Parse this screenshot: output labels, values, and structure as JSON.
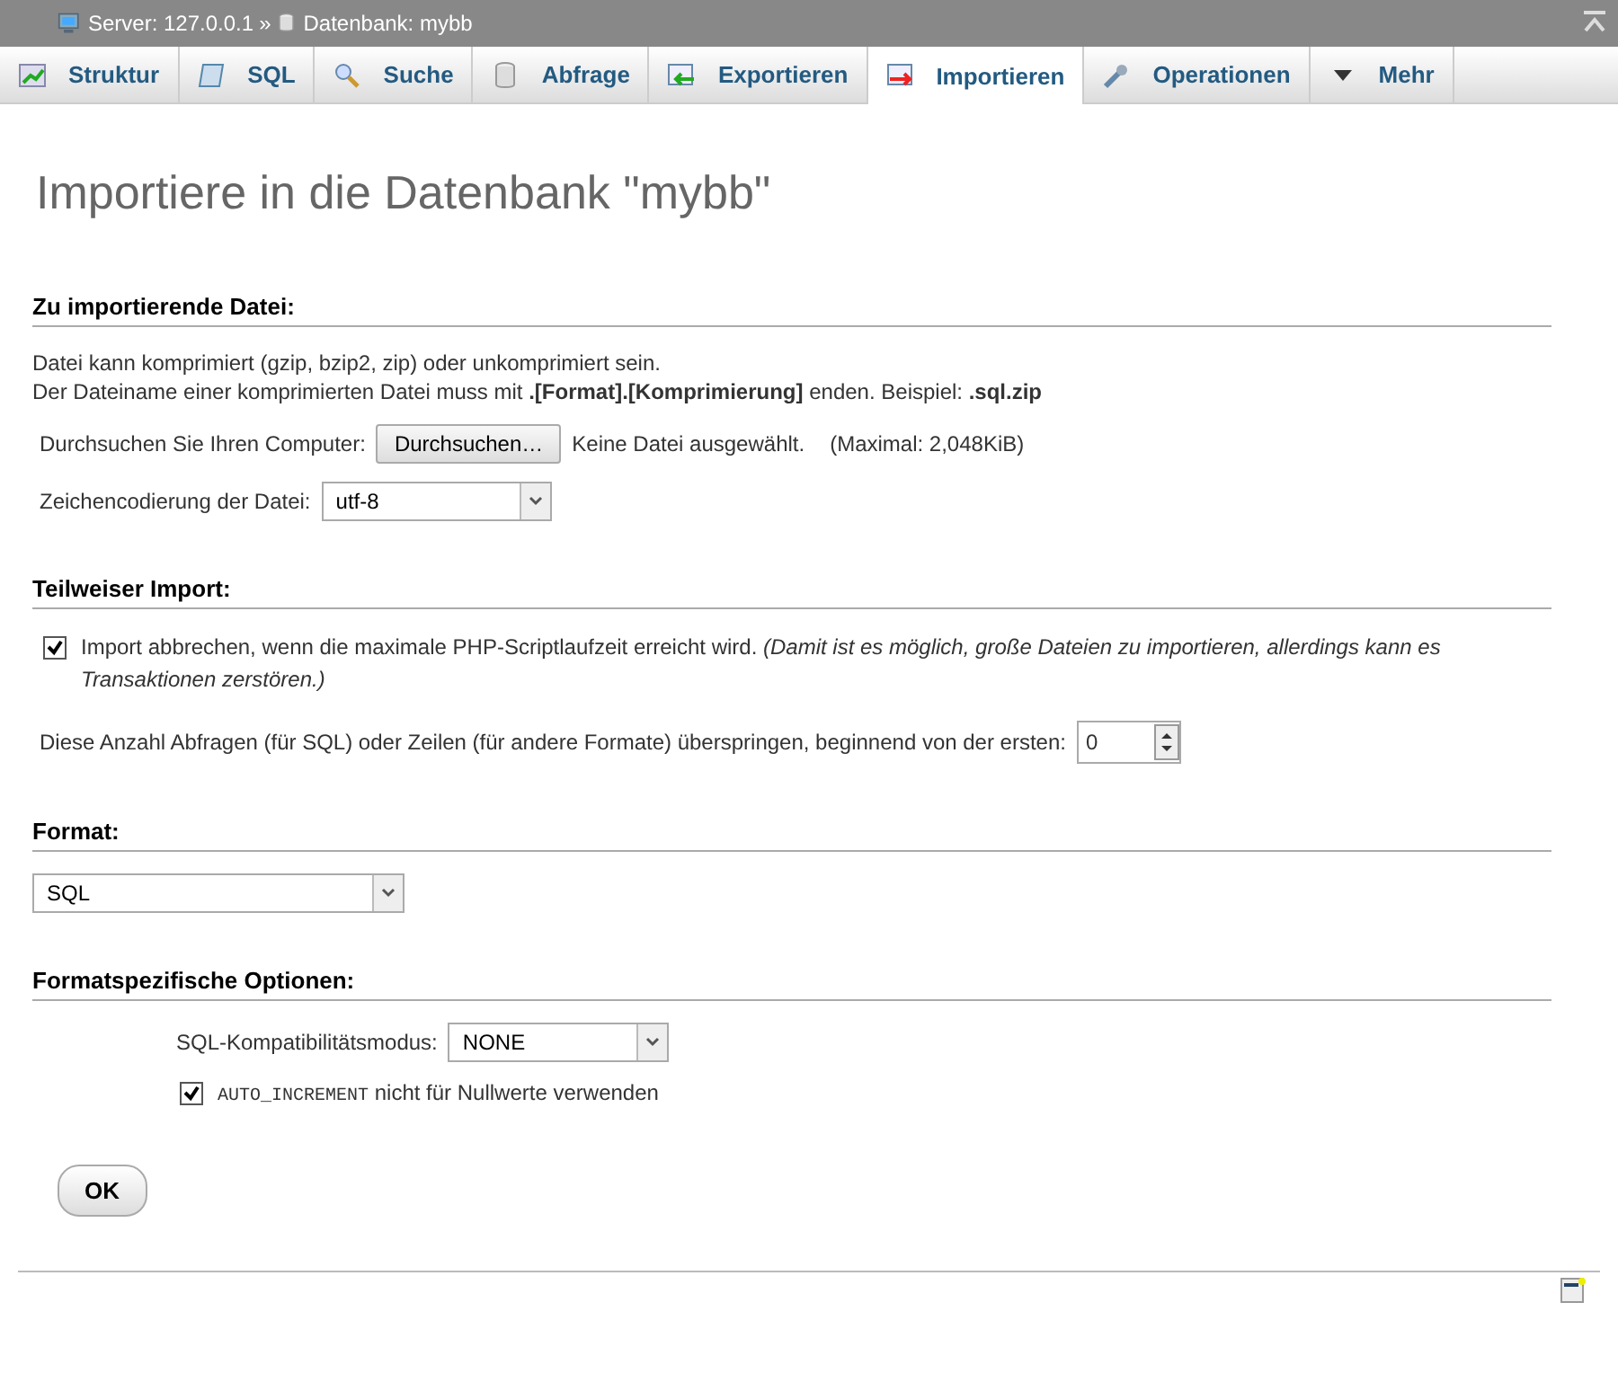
{
  "breadcrumb": [
    {
      "kind": "server",
      "text": "Server: 127.0.0.1"
    },
    {
      "kind": "separator",
      "text": "»"
    },
    {
      "kind": "database",
      "text": "Datenbank: mybb"
    }
  ],
  "tabs": [
    {
      "label": "Struktur",
      "kind": "structure",
      "selected": false
    },
    {
      "label": "SQL",
      "kind": "sql",
      "selected": false
    },
    {
      "label": "Suche",
      "kind": "search",
      "selected": false
    },
    {
      "label": "Abfrage",
      "kind": "query",
      "selected": false
    },
    {
      "label": "Exportieren",
      "kind": "export",
      "selected": false
    },
    {
      "label": "Importieren",
      "kind": "import",
      "selected": true
    },
    {
      "label": "Operationen",
      "kind": "operations",
      "selected": false
    },
    {
      "label": "Mehr",
      "kind": "more",
      "selected": false
    }
  ],
  "title": "Importiere in die Datenbank \"mybb\"",
  "file_section": {
    "heading": "Zu importierende Datei:",
    "notes": [
      "Datei kann komprimiert (gzip, bzip2, zip) oder unkomprimiert sein.",
      "Der Dateiname einer komprimierten Datei muss mit **.[Format].[Komprimierung]** enden. Beispiel: **.sql.zip**"
    ],
    "browse_label": "Durchsuchen Sie Ihren Computer:",
    "browse_button": "Durchsuchen…",
    "file_status": "Keine Datei ausgewählt.",
    "max_size": "(Maximal: 2,048KiB)",
    "charset_label": "Zeichencodierung der Datei:",
    "charset_value": "utf-8"
  },
  "partial_section": {
    "heading": "Teilweiser Import:",
    "abort_checkbox": {
      "label": "Import abbrechen, wenn die maximale PHP-Scriptlaufzeit erreicht wird. *(Damit ist es möglich, große Dateien zu importieren, allerdings kann es Transaktionen zerstören.)*",
      "checked": true
    },
    "skip_label": "Diese Anzahl Abfragen (für SQL) oder Zeilen (für andere Formate) überspringen, beginnend von der ersten:",
    "skip_value": "0"
  },
  "format_section": {
    "heading": "Format:",
    "format_value": "SQL"
  },
  "options_section": {
    "heading": "Formatspezifische Optionen:",
    "compat_label": "SQL-Kompatibilitätsmodus:",
    "compat_value": "NONE",
    "auto_increment": {
      "code": "AUTO_INCREMENT",
      "label": "nicht für Nullwerte verwenden",
      "checked": true
    }
  },
  "submit": "OK"
}
